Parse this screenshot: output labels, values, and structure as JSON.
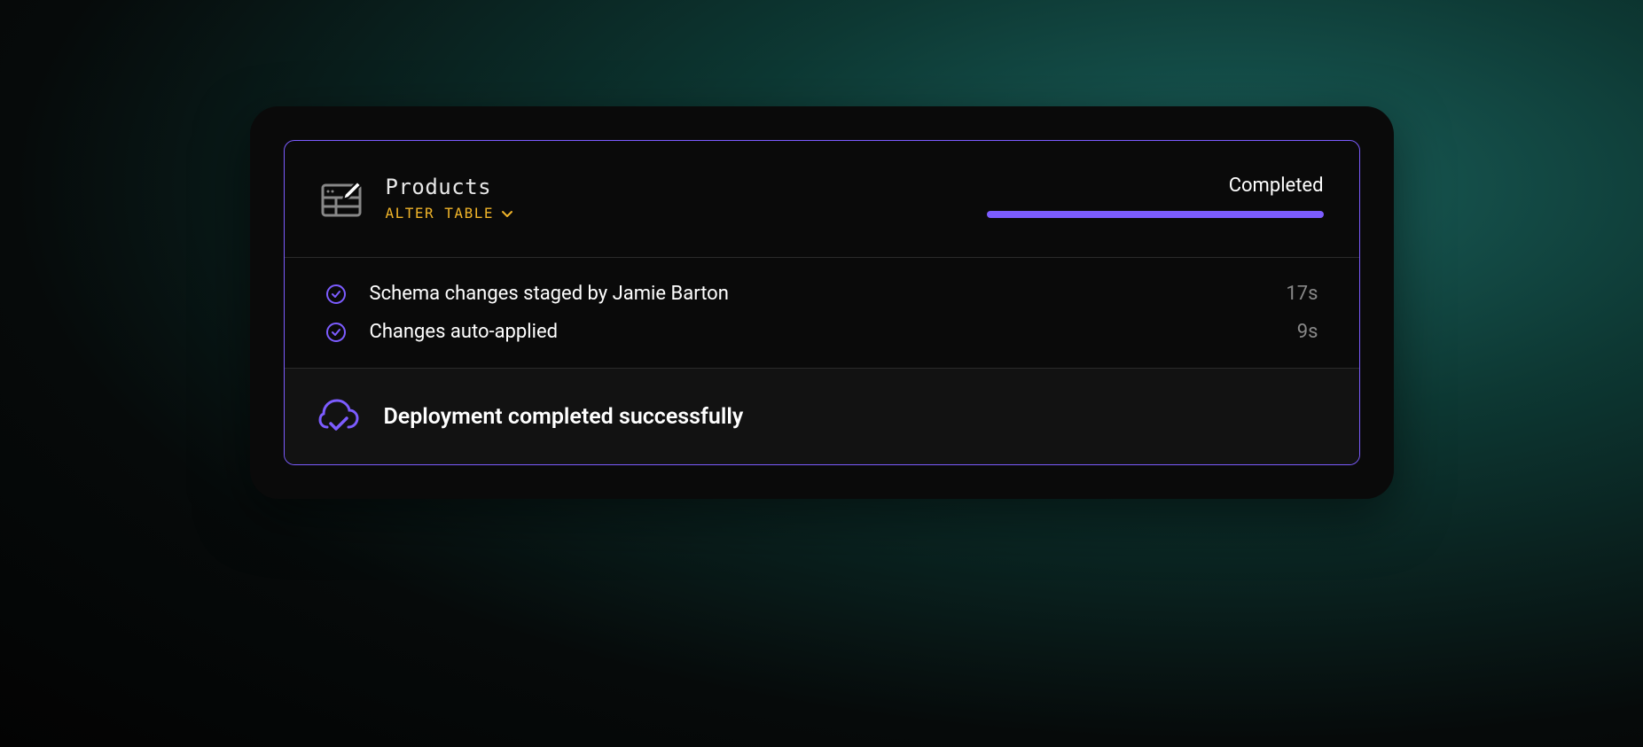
{
  "header": {
    "title": "Products",
    "subtitle": "ALTER TABLE",
    "status": "Completed"
  },
  "steps": [
    {
      "label": "Schema changes staged by Jamie Barton",
      "time": "17s"
    },
    {
      "label": "Changes auto-applied",
      "time": "9s"
    }
  ],
  "footer": {
    "message": "Deployment completed successfully"
  },
  "colors": {
    "accent": "#7c5cff",
    "warning": "#f0b429"
  }
}
